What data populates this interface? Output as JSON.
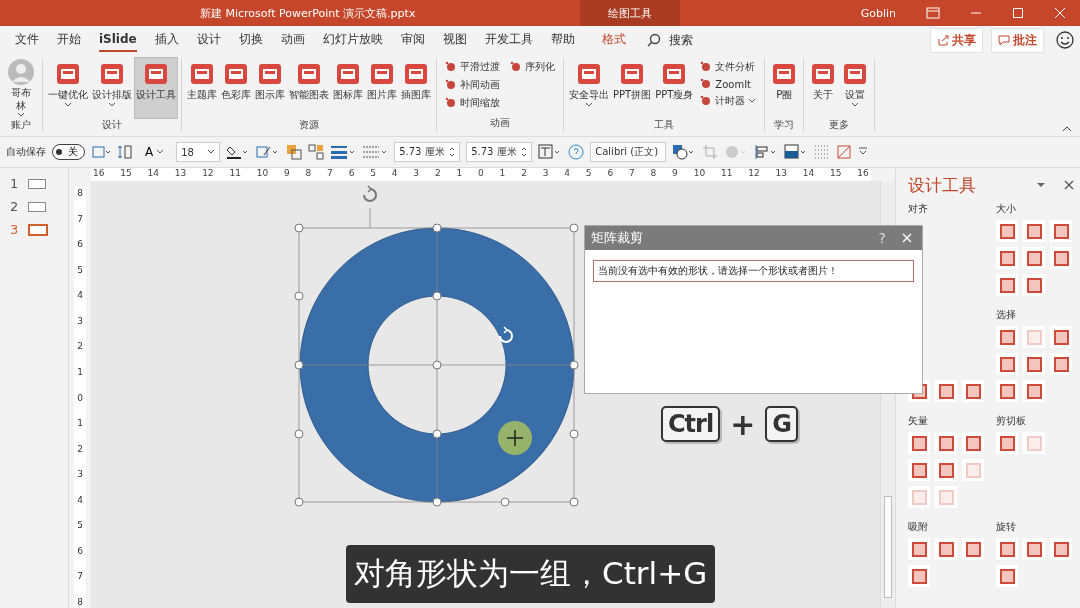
{
  "title_bar": {
    "title": "新建 Microsoft PowerPoint 演示文稿.pptx",
    "context_tab": "绘图工具",
    "user": "Goblin"
  },
  "tabs": [
    {
      "label": "文件",
      "selected": false,
      "kind": "normal"
    },
    {
      "label": "开始",
      "selected": false,
      "kind": "normal"
    },
    {
      "label": "iSlide",
      "selected": true,
      "kind": "normal"
    },
    {
      "label": "插入",
      "selected": false,
      "kind": "normal"
    },
    {
      "label": "设计",
      "selected": false,
      "kind": "normal"
    },
    {
      "label": "切换",
      "selected": false,
      "kind": "normal"
    },
    {
      "label": "动画",
      "selected": false,
      "kind": "normal"
    },
    {
      "label": "幻灯片放映",
      "selected": false,
      "kind": "normal"
    },
    {
      "label": "审阅",
      "selected": false,
      "kind": "normal"
    },
    {
      "label": "视图",
      "selected": false,
      "kind": "normal"
    },
    {
      "label": "开发工具",
      "selected": false,
      "kind": "normal"
    },
    {
      "label": "帮助",
      "selected": false,
      "kind": "normal"
    },
    {
      "label": "格式",
      "selected": false,
      "kind": "contextual"
    }
  ],
  "search": {
    "label": "搜索"
  },
  "share_button": "共享",
  "comments_button": "批注",
  "ribbon": [
    {
      "label": "账户",
      "items": [
        {
          "kind": "account",
          "label": "哥布林",
          "dropdown": true
        }
      ]
    },
    {
      "label": "设计",
      "items": [
        {
          "kind": "large",
          "label": "一键优化",
          "dropdown": true,
          "selected": false
        },
        {
          "kind": "large",
          "label": "设计排版",
          "dropdown": true,
          "selected": false
        },
        {
          "kind": "large",
          "label": "设计工具",
          "dropdown": false,
          "selected": true
        }
      ]
    },
    {
      "label": "资源",
      "items": [
        {
          "kind": "large",
          "label": "主题库",
          "dropdown": false,
          "selected": false
        },
        {
          "kind": "large",
          "label": "色彩库",
          "dropdown": false,
          "selected": false
        },
        {
          "kind": "large",
          "label": "图示库",
          "dropdown": false,
          "selected": false
        },
        {
          "kind": "large",
          "label": "智能图表",
          "dropdown": false,
          "selected": false
        },
        {
          "kind": "large",
          "label": "图标库",
          "dropdown": false,
          "selected": false
        },
        {
          "kind": "large",
          "label": "图片库",
          "dropdown": false,
          "selected": false
        },
        {
          "kind": "large",
          "label": "插图库",
          "dropdown": false,
          "selected": false
        }
      ]
    },
    {
      "label": "动画",
      "items": [
        {
          "kind": "small",
          "label": "平滑过渡",
          "dropdown": false
        },
        {
          "kind": "small",
          "label": "补间动画",
          "dropdown": false
        },
        {
          "kind": "small",
          "label": "时间缩放",
          "dropdown": false
        },
        {
          "kind": "small",
          "label": "序列化",
          "dropdown": false
        }
      ]
    },
    {
      "label": "工具",
      "items": [
        {
          "kind": "large",
          "label": "安全导出",
          "dropdown": true,
          "selected": false
        },
        {
          "kind": "large",
          "label": "PPT拼图",
          "dropdown": false,
          "selected": false
        },
        {
          "kind": "large",
          "label": "PPT瘦身",
          "dropdown": false,
          "selected": false
        },
        {
          "kind": "small",
          "label": "文件分析",
          "dropdown": false
        },
        {
          "kind": "small",
          "label": "ZoomIt",
          "dropdown": false
        },
        {
          "kind": "small",
          "label": "计时器",
          "dropdown": true
        }
      ]
    },
    {
      "label": "学习",
      "items": [
        {
          "kind": "large",
          "label": "P圈",
          "dropdown": false,
          "selected": false
        }
      ]
    },
    {
      "label": "更多",
      "items": [
        {
          "kind": "large",
          "label": "关于",
          "dropdown": false,
          "selected": false
        },
        {
          "kind": "large",
          "label": "设置",
          "dropdown": true,
          "selected": false
        }
      ]
    }
  ],
  "format_bar": {
    "autosave_label": "自动保存",
    "autosave_on": false,
    "autosave_state": "关",
    "font_color_letter": "A",
    "font_size": "18",
    "height": "5.73 厘米",
    "width": "5.73 厘米",
    "font": "Calibri (正文)"
  },
  "ruler": {
    "horizontal": [
      "16",
      "15",
      "14",
      "13",
      "12",
      "11",
      "10",
      "9",
      "8",
      "7",
      "6",
      "5",
      "4",
      "3",
      "2",
      "1",
      "0",
      "1",
      "2",
      "3",
      "4",
      "5",
      "6",
      "7",
      "8",
      "9",
      "10",
      "11",
      "12",
      "13",
      "14",
      "15",
      "16"
    ],
    "vertical": [
      "8",
      "7",
      "6",
      "5",
      "4",
      "3",
      "2",
      "1",
      "0",
      "1",
      "2",
      "3",
      "4",
      "5",
      "6",
      "7",
      "8"
    ]
  },
  "slides": [
    {
      "number": "1",
      "selected": false
    },
    {
      "number": "2",
      "selected": false
    },
    {
      "number": "3",
      "selected": true
    }
  ],
  "dialog": {
    "title": "矩阵裁剪",
    "help": "?",
    "message": "当前没有选中有效的形状，请选择一个形状或者图片！"
  },
  "shortcut": {
    "keys": [
      "Ctrl",
      "G"
    ],
    "plus": "+"
  },
  "subtitle": "对角形状为一组，Ctrl+G",
  "panel": {
    "title": "设计工具",
    "sections": [
      {
        "label": "对齐",
        "icons": [
          {
            "disabled": false
          },
          {
            "disabled": false
          },
          {
            "disabled": false
          }
        ]
      },
      {
        "label": "大小",
        "icons": [
          {
            "disabled": false
          },
          {
            "disabled": false
          },
          {
            "disabled": false
          },
          {
            "disabled": false
          },
          {
            "disabled": false
          },
          {
            "disabled": false
          },
          {
            "disabled": false
          },
          {
            "disabled": false
          }
        ]
      },
      {
        "label": "选择",
        "icons": [
          {
            "disabled": false
          },
          {
            "disabled": true
          },
          {
            "disabled": false
          },
          {
            "disabled": false
          },
          {
            "disabled": false
          },
          {
            "disabled": false
          },
          {
            "disabled": false
          },
          {
            "disabled": false
          }
        ]
      },
      {
        "label": "矢量",
        "icons": [
          {
            "disabled": false
          },
          {
            "disabled": false
          },
          {
            "disabled": false
          },
          {
            "disabled": false
          },
          {
            "disabled": false
          },
          {
            "disabled": true
          },
          {
            "disabled": true
          },
          {
            "disabled": true
          }
        ]
      },
      {
        "label": "剪切板",
        "icons": [
          {
            "disabled": false
          },
          {
            "disabled": true
          }
        ]
      },
      {
        "label": "吸附",
        "icons": [
          {
            "disabled": false
          },
          {
            "disabled": false
          },
          {
            "disabled": false
          },
          {
            "disabled": false
          }
        ]
      },
      {
        "label": "旋转",
        "icons": [
          {
            "disabled": false
          },
          {
            "disabled": false
          },
          {
            "disabled": false
          },
          {
            "disabled": false
          }
        ]
      }
    ]
  }
}
